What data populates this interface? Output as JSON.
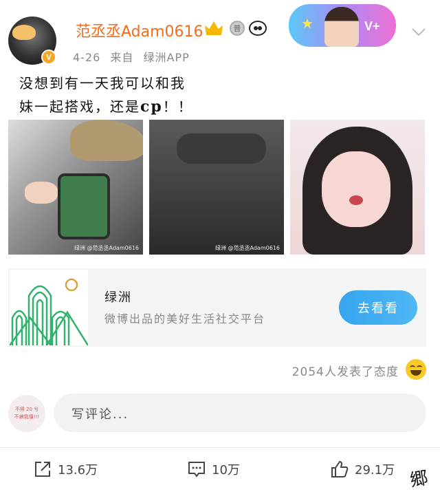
{
  "user": {
    "name": "范丞丞Adam0616",
    "verified_mark": "V",
    "date": "4-26",
    "source_prefix": "来自",
    "source": "绿洲APP",
    "medal_text": "普",
    "vip_text": "V+"
  },
  "post": {
    "line1": "没想到有一天我可以和我",
    "line2_start": "妹一起搭戏，还是",
    "line2_bold": "cp",
    "line2_end": "！！",
    "photo_watermark_1": "绿洲 @范丞丞Adam0616",
    "photo_watermark_2": "绿洲 @范丞丞Adam0616"
  },
  "card": {
    "title": "绿洲",
    "subtitle": "微博出品的美好生活社交平台",
    "button": "去看看"
  },
  "reaction": {
    "text": "2054人发表了态度"
  },
  "comment": {
    "placeholder": "写评论...",
    "avatar_line1": "不得 20 兮",
    "avatar_line2": "不搞我懂!!!"
  },
  "actions": {
    "repost": "13.6万",
    "comment": "10万",
    "like": "29.1万"
  },
  "signature": "郷"
}
